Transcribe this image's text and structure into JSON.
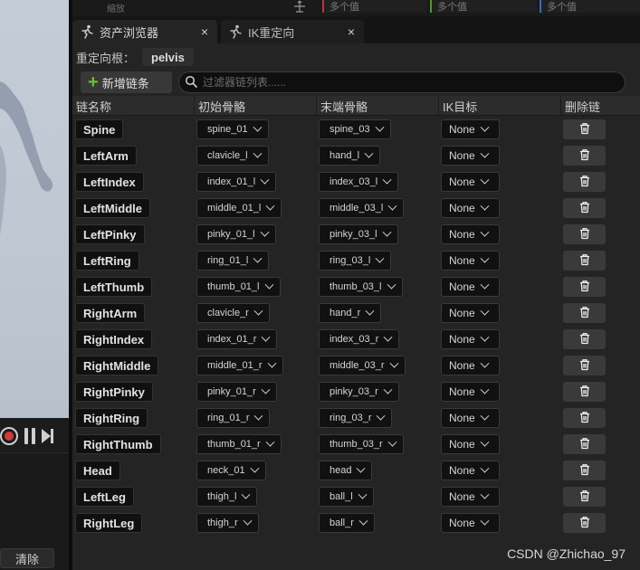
{
  "top_strip": {
    "zoom_label": "缩放",
    "multi_values": [
      "多个值",
      "多个值",
      "多个值"
    ]
  },
  "tabs": [
    {
      "label": "资产浏览器",
      "close": "×"
    },
    {
      "label": "IK重定向",
      "close": "×"
    }
  ],
  "retarget_root": {
    "label": "重定向根：",
    "value": "pelvis"
  },
  "toolbar": {
    "add_chain_label": "新增链条",
    "filter_placeholder": "过滤器链列表......"
  },
  "columns": [
    "链名称",
    "初始骨骼",
    "末端骨骼",
    "IK目标",
    "删除链"
  ],
  "chains": [
    {
      "name": "Spine",
      "start": "spine_01",
      "end": "spine_03",
      "ik": "None"
    },
    {
      "name": "LeftArm",
      "start": "clavicle_l",
      "end": "hand_l",
      "ik": "None"
    },
    {
      "name": "LeftIndex",
      "start": "index_01_l",
      "end": "index_03_l",
      "ik": "None"
    },
    {
      "name": "LeftMiddle",
      "start": "middle_01_l",
      "end": "middle_03_l",
      "ik": "None"
    },
    {
      "name": "LeftPinky",
      "start": "pinky_01_l",
      "end": "pinky_03_l",
      "ik": "None"
    },
    {
      "name": "LeftRing",
      "start": "ring_01_l",
      "end": "ring_03_l",
      "ik": "None"
    },
    {
      "name": "LeftThumb",
      "start": "thumb_01_l",
      "end": "thumb_03_l",
      "ik": "None"
    },
    {
      "name": "RightArm",
      "start": "clavicle_r",
      "end": "hand_r",
      "ik": "None"
    },
    {
      "name": "RightIndex",
      "start": "index_01_r",
      "end": "index_03_r",
      "ik": "None"
    },
    {
      "name": "RightMiddle",
      "start": "middle_01_r",
      "end": "middle_03_r",
      "ik": "None"
    },
    {
      "name": "RightPinky",
      "start": "pinky_01_r",
      "end": "pinky_03_r",
      "ik": "None"
    },
    {
      "name": "RightRing",
      "start": "ring_01_r",
      "end": "ring_03_r",
      "ik": "None"
    },
    {
      "name": "RightThumb",
      "start": "thumb_01_r",
      "end": "thumb_03_r",
      "ik": "None"
    },
    {
      "name": "Head",
      "start": "neck_01",
      "end": "head",
      "ik": "None"
    },
    {
      "name": "LeftLeg",
      "start": "thigh_l",
      "end": "ball_l",
      "ik": "None"
    },
    {
      "name": "RightLeg",
      "start": "thigh_r",
      "end": "ball_r",
      "ik": "None"
    }
  ],
  "viewport": {
    "clear_label": "清除"
  },
  "watermark": "CSDN @Zhichao_97",
  "colors": {
    "accent_green": "#6fbf2e",
    "record_red": "#d23a3a",
    "axis_x": "#b43a2f",
    "axis_y": "#4c9a36",
    "axis_z": "#3a6ac2"
  },
  "icons": {
    "tab_asset_browser": "running-figure-icon",
    "tab_ik_retarget": "running-figure-icon",
    "delete": "trash-icon",
    "filter": "search-icon"
  }
}
